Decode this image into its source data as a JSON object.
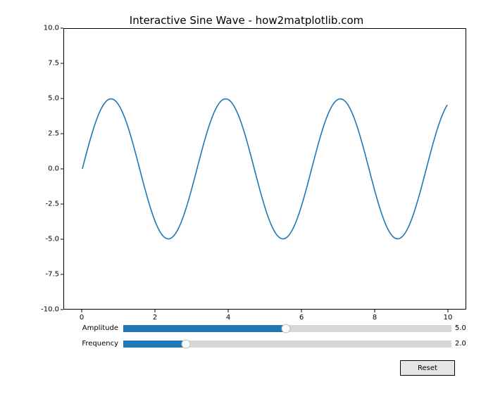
{
  "chart_data": {
    "type": "line",
    "title": "Interactive Sine Wave - how2matplotlib.com",
    "formula": "y = amplitude * sin(frequency * x)",
    "params": {
      "amplitude": 5.0,
      "frequency": 2.0
    },
    "x_range": [
      0,
      10
    ],
    "xlim": [
      -0.5,
      10.5
    ],
    "ylim": [
      -10.0,
      10.0
    ],
    "xticks": [
      0,
      2,
      4,
      6,
      8,
      10
    ],
    "yticks": [
      -10.0,
      -7.5,
      -5.0,
      -2.5,
      0.0,
      2.5,
      5.0,
      7.5,
      10.0
    ],
    "xlabel": "",
    "ylabel": "",
    "line_color": "#1f77b4"
  },
  "sliders": {
    "amplitude": {
      "label": "Amplitude",
      "min": 0.1,
      "max": 10.0,
      "value": 5.0,
      "value_text": "5.0"
    },
    "frequency": {
      "label": "Frequency",
      "min": 0.1,
      "max": 10.0,
      "value": 2.0,
      "value_text": "2.0"
    }
  },
  "reset_label": "Reset",
  "ytick_labels": [
    "-10.0",
    "-7.5",
    "-5.0",
    "-2.5",
    "0.0",
    "2.5",
    "5.0",
    "7.5",
    "10.0"
  ],
  "xtick_labels": [
    "0",
    "2",
    "4",
    "6",
    "8",
    "10"
  ]
}
